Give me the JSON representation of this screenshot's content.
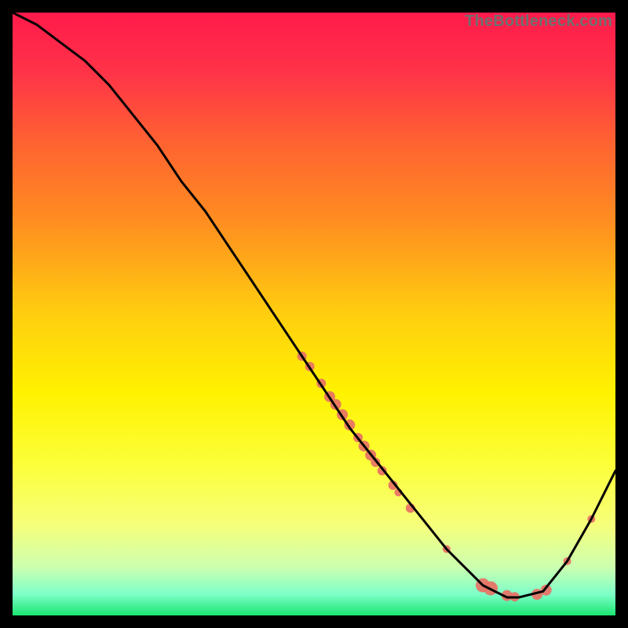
{
  "watermark": "TheBottleneck.com",
  "gradient": {
    "stops": [
      {
        "offset": 0.0,
        "color": "#ff1a4b"
      },
      {
        "offset": 0.1,
        "color": "#ff3348"
      },
      {
        "offset": 0.22,
        "color": "#ff6430"
      },
      {
        "offset": 0.35,
        "color": "#ff8f20"
      },
      {
        "offset": 0.5,
        "color": "#ffce0f"
      },
      {
        "offset": 0.63,
        "color": "#fff200"
      },
      {
        "offset": 0.75,
        "color": "#fcff3a"
      },
      {
        "offset": 0.85,
        "color": "#f6ff7a"
      },
      {
        "offset": 0.92,
        "color": "#ccffb0"
      },
      {
        "offset": 0.965,
        "color": "#7dffc8"
      },
      {
        "offset": 1.0,
        "color": "#19e570"
      }
    ]
  },
  "chart_data": {
    "type": "line",
    "title": "",
    "xlabel": "",
    "ylabel": "",
    "xlim": [
      0,
      100
    ],
    "ylim": [
      0,
      100
    ],
    "grid": false,
    "legend": false,
    "series": [
      {
        "name": "curve",
        "x": [
          0,
          4,
          8,
          12,
          16,
          20,
          24,
          28,
          32,
          36,
          40,
          44,
          48,
          52,
          56,
          60,
          64,
          68,
          72,
          74,
          76,
          78,
          80,
          82,
          84,
          88,
          92,
          96,
          100
        ],
        "y": [
          100,
          98,
          95,
          92,
          88,
          83,
          78,
          72,
          67,
          61,
          55,
          49,
          43,
          37,
          31,
          26,
          21,
          16,
          11,
          9,
          7,
          5,
          4,
          3,
          3,
          4,
          9,
          16,
          24
        ]
      }
    ],
    "scatter": {
      "name": "points-on-curve",
      "points": [
        {
          "x": 48.0,
          "y": 43.0,
          "r": 6
        },
        {
          "x": 49.3,
          "y": 41.3,
          "r": 6
        },
        {
          "x": 51.2,
          "y": 38.5,
          "r": 6
        },
        {
          "x": 52.6,
          "y": 36.3,
          "r": 7
        },
        {
          "x": 53.6,
          "y": 35.0,
          "r": 7
        },
        {
          "x": 54.7,
          "y": 33.3,
          "r": 7
        },
        {
          "x": 55.9,
          "y": 31.6,
          "r": 7
        },
        {
          "x": 57.3,
          "y": 29.5,
          "r": 6
        },
        {
          "x": 58.3,
          "y": 28.1,
          "r": 7
        },
        {
          "x": 59.4,
          "y": 26.6,
          "r": 7
        },
        {
          "x": 60.2,
          "y": 25.4,
          "r": 6
        },
        {
          "x": 61.3,
          "y": 24.0,
          "r": 6
        },
        {
          "x": 63.1,
          "y": 21.6,
          "r": 6
        },
        {
          "x": 64.0,
          "y": 20.4,
          "r": 5
        },
        {
          "x": 66.0,
          "y": 17.8,
          "r": 6
        },
        {
          "x": 72.0,
          "y": 11.0,
          "r": 5
        },
        {
          "x": 78.0,
          "y": 5.0,
          "r": 9
        },
        {
          "x": 79.3,
          "y": 4.5,
          "r": 9
        },
        {
          "x": 82.0,
          "y": 3.3,
          "r": 7
        },
        {
          "x": 83.3,
          "y": 3.1,
          "r": 6
        },
        {
          "x": 87.0,
          "y": 3.5,
          "r": 7
        },
        {
          "x": 88.5,
          "y": 4.2,
          "r": 7
        },
        {
          "x": 92.0,
          "y": 9.0,
          "r": 5
        },
        {
          "x": 96.0,
          "y": 16.0,
          "r": 5
        }
      ]
    },
    "marker_color": "#e77165",
    "line_color": "#000000",
    "line_width": 3
  }
}
